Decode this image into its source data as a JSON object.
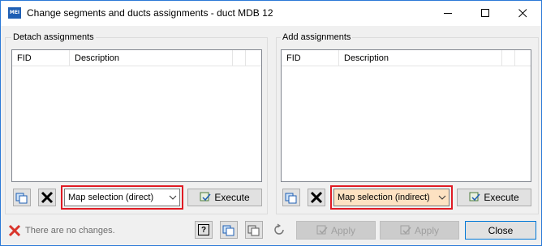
{
  "window": {
    "title": "Change segments and ducts assignments - duct MDB 12",
    "app_icon_text": "MEI",
    "minimize_icon": "minimize-icon",
    "maximize_icon": "maximize-icon",
    "close_icon": "close-icon"
  },
  "detach": {
    "group_label": "Detach assignments",
    "columns": [
      "FID",
      "Description"
    ],
    "combo_value": "Map selection (direct)",
    "execute_label": "Execute"
  },
  "add": {
    "group_label": "Add assignments",
    "columns": [
      "FID",
      "Description"
    ],
    "combo_value": "Map selection (indirect)",
    "combo_bg": "#fde2c2",
    "execute_label": "Execute"
  },
  "footer": {
    "status_text": "There are no changes.",
    "help_label": "?",
    "apply1_label": "Apply",
    "apply2_label": "Apply",
    "close_label": "Close"
  },
  "colors": {
    "highlight": "#e01b24",
    "accent": "#1f5fb4",
    "x_red": "#d9342b"
  }
}
